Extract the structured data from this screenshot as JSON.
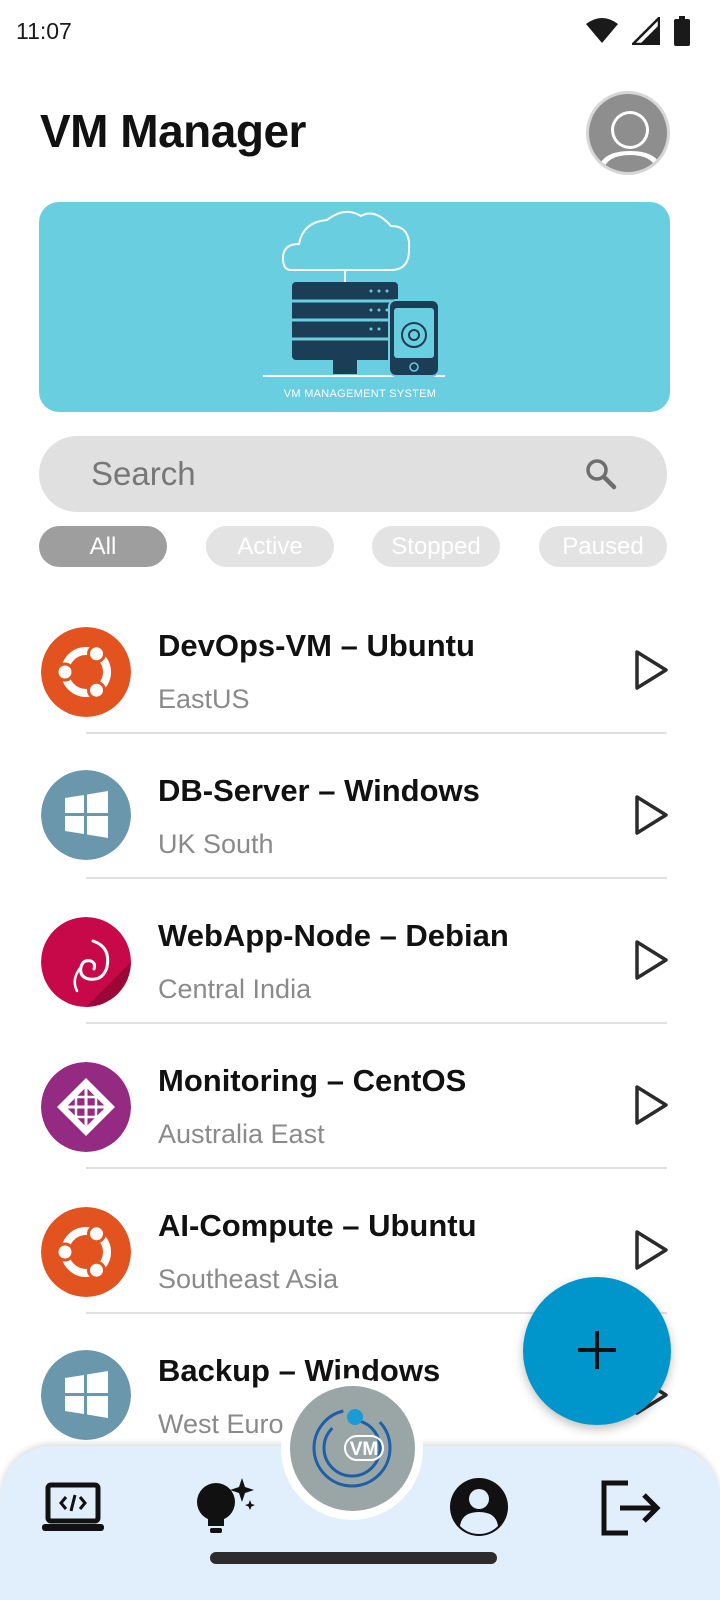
{
  "status_bar": {
    "time": "11:07",
    "icons": [
      "wifi-icon",
      "cell-signal-icon",
      "battery-icon"
    ]
  },
  "header": {
    "title": "VM Manager",
    "avatar_icon": "user-avatar-icon"
  },
  "banner": {
    "caption": "VM MANAGEMENT SYSTEM",
    "bg_color": "#69cfe0"
  },
  "search": {
    "placeholder": "Search",
    "icon": "search-icon"
  },
  "filters": {
    "selected": "All",
    "chips": [
      "All",
      "Active",
      "Stopped",
      "Paused"
    ]
  },
  "vms": [
    {
      "name": "DevOps-VM – Ubuntu",
      "region": "EastUS",
      "os": "ubuntu",
      "logo_color": "#e2531f"
    },
    {
      "name": "DB-Server – Windows",
      "region": "UK South",
      "os": "windows",
      "logo_color": "#6a97ab"
    },
    {
      "name": "WebApp-Node – Debian",
      "region": "Central India",
      "os": "debian",
      "logo_color": "#c7094a"
    },
    {
      "name": "Monitoring – CentOS",
      "region": "Australia East",
      "os": "centos",
      "logo_color": "#942a82"
    },
    {
      "name": "AI-Compute – Ubuntu",
      "region": "Southeast Asia",
      "os": "ubuntu",
      "logo_color": "#e2531f"
    },
    {
      "name": "Backup – Windows",
      "region": "West Euro",
      "os": "windows",
      "logo_color": "#6a97ab"
    }
  ],
  "fab": {
    "icon": "plus-icon",
    "color": "#0096cc"
  },
  "bottom_nav": {
    "items": [
      "laptop-code-icon",
      "lightbulb-sparkle-icon",
      "profile-icon",
      "logout-icon"
    ],
    "center_badge_text": "VM",
    "bg_color": "#e1eefb"
  }
}
